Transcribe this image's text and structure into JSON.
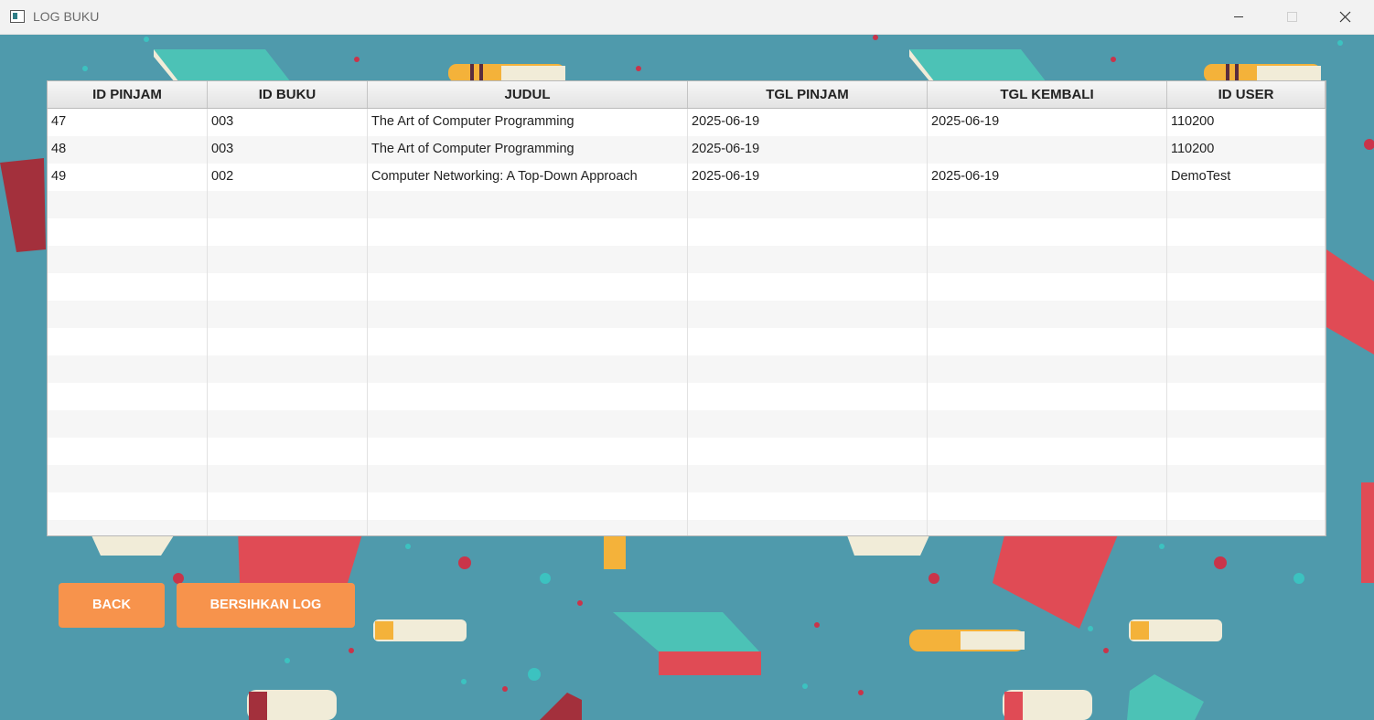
{
  "window": {
    "title": "LOG BUKU"
  },
  "table": {
    "columns": [
      "ID PINJAM",
      "ID BUKU",
      "JUDUL",
      "TGL PINJAM",
      "TGL KEMBALI",
      "ID USER"
    ],
    "rows": [
      [
        "47",
        "003",
        "The Art of Computer Programming",
        "2025-06-19",
        "2025-06-19",
        "110200"
      ],
      [
        "48",
        "003",
        "The Art of Computer Programming",
        "2025-06-19",
        "",
        "110200"
      ],
      [
        "49",
        "002",
        "Computer Networking: A Top-Down Approach",
        "2025-06-19",
        "2025-06-19",
        "DemoTest"
      ]
    ]
  },
  "buttons": {
    "back_label": "BACK",
    "clear_label": "BERSIHKAN LOG"
  },
  "colors": {
    "background": "#4f9aac",
    "button": "#f7934c",
    "book_teal": "#4cc2b6",
    "book_red": "#e04b55",
    "book_yellow": "#f4b23a"
  }
}
